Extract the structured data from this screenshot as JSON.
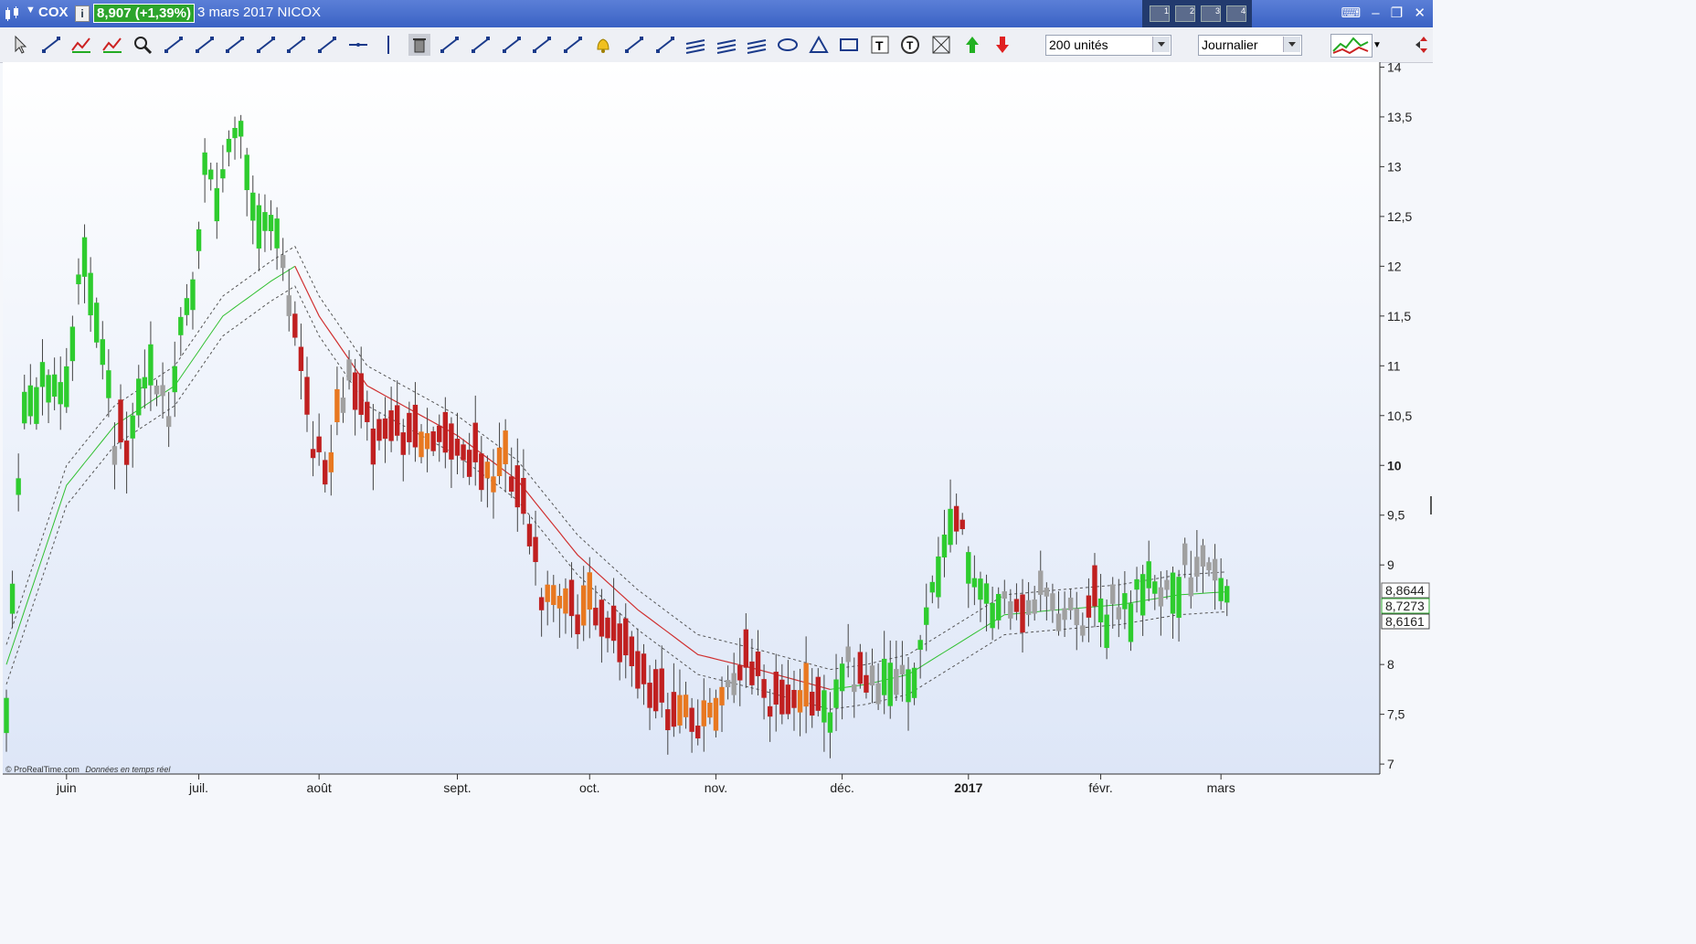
{
  "window": {
    "ticker": "COX",
    "price_badge": "8,907 (+1,39%)",
    "date_name": "3 mars 2017 NICOX",
    "layout_tabs": [
      "1",
      "2",
      "3",
      "4"
    ]
  },
  "toolbar": {
    "units": "200 unités",
    "period": "Journalier",
    "tools": [
      "cursor-icon",
      "ruler-icon",
      "trend-icon",
      "zigzag-icon",
      "zoom-icon",
      "hline-icon",
      "channel-icon",
      "segment-icon",
      "line-icon",
      "ray-icon",
      "extended-line-icon",
      "horizontal-line-icon",
      "vertical-line-icon",
      "delete-icon",
      "crosshair-icon",
      "measure-icon",
      "indicator-icon",
      "fibonacci-icon",
      "fibonacci-fan-icon",
      "alert-bell-icon",
      "andrews-icon",
      "gann-icon",
      "epsilon-icon",
      "raff-icon",
      "sigma-icon",
      "ellipse-icon",
      "triangle-icon",
      "rectangle-icon",
      "text-t-icon",
      "text-bubble-icon",
      "grid-g-icon",
      "arrow-up-icon",
      "arrow-down-icon"
    ]
  },
  "colors": {
    "bull": "#2ecc2e",
    "bear": "#c02020",
    "bear_orange": "#e87820",
    "neutral": "#a0a0a0",
    "mid_line": "#d03030",
    "mid_line_green": "#30c030",
    "band": "#555555",
    "bg_top": "#ffffff",
    "bg_bottom": "#dde6f7"
  },
  "chart_data": {
    "type": "candlestick",
    "period": "Journalier",
    "ylim": [
      6.9,
      14.05
    ],
    "yticks": [
      {
        "v": 14,
        "label": "14"
      },
      {
        "v": 13.5,
        "label": "13,5"
      },
      {
        "v": 13,
        "label": "13"
      },
      {
        "v": 12.5,
        "label": "12,5"
      },
      {
        "v": 12,
        "label": "12"
      },
      {
        "v": 11.5,
        "label": "11,5"
      },
      {
        "v": 11,
        "label": "11"
      },
      {
        "v": 10.5,
        "label": "10,5"
      },
      {
        "v": 10,
        "label": "10",
        "bold": true
      },
      {
        "v": 9.5,
        "label": "9,5"
      },
      {
        "v": 9,
        "label": "9"
      },
      {
        "v": 8,
        "label": "8"
      },
      {
        "v": 7.5,
        "label": "7,5"
      },
      {
        "v": 7,
        "label": "7"
      }
    ],
    "xticks": [
      {
        "i": 10,
        "label": "juin"
      },
      {
        "i": 32,
        "label": "juil."
      },
      {
        "i": 52,
        "label": "août"
      },
      {
        "i": 75,
        "label": "sept."
      },
      {
        "i": 97,
        "label": "oct."
      },
      {
        "i": 118,
        "label": "nov."
      },
      {
        "i": 139,
        "label": "déc."
      },
      {
        "i": 160,
        "label": "2017",
        "bold": true
      },
      {
        "i": 182,
        "label": "févr."
      },
      {
        "i": 202,
        "label": "mars"
      }
    ],
    "price_labels": [
      {
        "v": 8.8644,
        "label": "8,8644",
        "color": "#666666"
      },
      {
        "v": 8.7273,
        "label": "8,7273",
        "color": "#2ca42c"
      },
      {
        "v": 8.6161,
        "label": "8,6161",
        "color": "#444444"
      }
    ],
    "footnote_source": "© ProRealTime.com",
    "footnote_text": "Données en temps réel",
    "anchors": [
      [
        0,
        7.8,
        "bull"
      ],
      [
        3,
        10.8,
        "bull"
      ],
      [
        6,
        10.9,
        "bull"
      ],
      [
        9,
        10.9,
        "bull"
      ],
      [
        11,
        11.3,
        "bull"
      ],
      [
        13,
        12.3,
        "bull"
      ],
      [
        15,
        11.7,
        "bull"
      ],
      [
        17,
        11.0,
        "bull"
      ],
      [
        18,
        10.3,
        "neutral"
      ],
      [
        20,
        10.0,
        "bear"
      ],
      [
        22,
        10.8,
        "bull"
      ],
      [
        24,
        11.2,
        "bull"
      ],
      [
        25,
        10.9,
        "neutral"
      ],
      [
        27,
        10.5,
        "neutral"
      ],
      [
        29,
        11.5,
        "bull"
      ],
      [
        31,
        12.0,
        "bull"
      ],
      [
        33,
        13.0,
        "bull"
      ],
      [
        35,
        12.7,
        "bull"
      ],
      [
        37,
        13.2,
        "bull"
      ],
      [
        39,
        13.5,
        "bull"
      ],
      [
        41,
        12.8,
        "bull"
      ],
      [
        43,
        12.5,
        "bull"
      ],
      [
        45,
        12.6,
        "bull"
      ],
      [
        47,
        11.6,
        "neutral"
      ],
      [
        49,
        11.0,
        "bear"
      ],
      [
        51,
        10.2,
        "bear"
      ],
      [
        53,
        9.8,
        "bear"
      ],
      [
        55,
        10.3,
        "bear_orange"
      ],
      [
        57,
        10.8,
        "neutral"
      ],
      [
        59,
        10.5,
        "bear"
      ],
      [
        61,
        10.1,
        "bear"
      ],
      [
        63,
        10.3,
        "bear"
      ],
      [
        66,
        10.2,
        "bear"
      ],
      [
        68,
        10.1,
        "bear"
      ],
      [
        70,
        10.3,
        "bear_orange"
      ],
      [
        72,
        10.2,
        "bear"
      ],
      [
        75,
        10.1,
        "bear"
      ],
      [
        77,
        10.0,
        "bear"
      ],
      [
        79,
        9.8,
        "bear"
      ],
      [
        81,
        9.8,
        "bear_orange"
      ],
      [
        83,
        9.9,
        "bear_orange"
      ],
      [
        85,
        9.6,
        "bear"
      ],
      [
        87,
        9.2,
        "bear"
      ],
      [
        89,
        8.6,
        "bear"
      ],
      [
        91,
        8.5,
        "bear_orange"
      ],
      [
        93,
        8.5,
        "bear_orange"
      ],
      [
        95,
        8.3,
        "bear"
      ],
      [
        97,
        8.6,
        "bear_orange"
      ],
      [
        99,
        8.3,
        "bear"
      ],
      [
        101,
        8.2,
        "bear"
      ],
      [
        103,
        8.1,
        "bear"
      ],
      [
        105,
        7.9,
        "bear"
      ],
      [
        107,
        7.6,
        "bear"
      ],
      [
        109,
        7.5,
        "bear"
      ],
      [
        111,
        7.4,
        "bear"
      ],
      [
        113,
        7.5,
        "bear_orange"
      ],
      [
        115,
        7.3,
        "bear"
      ],
      [
        117,
        7.35,
        "bear_orange"
      ],
      [
        119,
        7.6,
        "bear_orange"
      ],
      [
        121,
        7.9,
        "neutral"
      ],
      [
        123,
        8.0,
        "bear"
      ],
      [
        125,
        7.8,
        "bear"
      ],
      [
        127,
        7.6,
        "bear"
      ],
      [
        129,
        7.55,
        "bear"
      ],
      [
        131,
        7.6,
        "bear"
      ],
      [
        133,
        7.55,
        "bear_orange"
      ],
      [
        135,
        7.6,
        "bear"
      ],
      [
        137,
        7.6,
        "bull"
      ],
      [
        139,
        8.0,
        "bull"
      ],
      [
        141,
        7.9,
        "neutral"
      ],
      [
        143,
        7.8,
        "bear"
      ],
      [
        145,
        7.9,
        "neutral"
      ],
      [
        147,
        7.95,
        "bull"
      ],
      [
        149,
        7.9,
        "neutral"
      ],
      [
        151,
        8.0,
        "bull"
      ],
      [
        153,
        8.6,
        "bull"
      ],
      [
        155,
        9.1,
        "bull"
      ],
      [
        157,
        9.6,
        "bull"
      ],
      [
        159,
        9.3,
        "bear"
      ],
      [
        161,
        9.0,
        "bull"
      ],
      [
        163,
        8.8,
        "bull"
      ],
      [
        165,
        8.6,
        "bull"
      ],
      [
        167,
        8.5,
        "neutral"
      ],
      [
        169,
        8.4,
        "bear"
      ],
      [
        171,
        8.6,
        "neutral"
      ],
      [
        173,
        8.6,
        "neutral"
      ],
      [
        175,
        8.55,
        "neutral"
      ],
      [
        177,
        8.5,
        "neutral"
      ],
      [
        179,
        8.4,
        "neutral"
      ],
      [
        181,
        8.45,
        "bear"
      ],
      [
        183,
        8.6,
        "bull"
      ],
      [
        185,
        8.7,
        "neutral"
      ],
      [
        187,
        8.7,
        "bull"
      ],
      [
        189,
        9.0,
        "bull"
      ],
      [
        191,
        8.9,
        "bull"
      ],
      [
        193,
        8.8,
        "neutral"
      ],
      [
        195,
        8.9,
        "bull"
      ],
      [
        197,
        8.85,
        "neutral"
      ],
      [
        199,
        8.95,
        "neutral"
      ],
      [
        201,
        8.85,
        "neutral"
      ],
      [
        203,
        8.9,
        "bull"
      ]
    ],
    "bands": {
      "mid": [
        [
          0,
          8.0
        ],
        [
          10,
          9.8
        ],
        [
          18,
          10.4
        ],
        [
          28,
          10.8
        ],
        [
          36,
          11.5
        ],
        [
          44,
          11.85
        ],
        [
          48,
          12.0
        ],
        [
          52,
          11.5
        ],
        [
          60,
          10.8
        ],
        [
          75,
          10.3
        ],
        [
          85,
          9.85
        ],
        [
          95,
          9.1
        ],
        [
          105,
          8.55
        ],
        [
          115,
          8.1
        ],
        [
          125,
          7.95
        ],
        [
          137,
          7.75
        ],
        [
          143,
          7.8
        ],
        [
          150,
          7.9
        ],
        [
          158,
          8.2
        ],
        [
          166,
          8.5
        ],
        [
          175,
          8.55
        ],
        [
          185,
          8.6
        ],
        [
          195,
          8.7
        ],
        [
          203,
          8.73
        ]
      ],
      "split": 48,
      "upper_offset": 0.2,
      "lower_offset": 0.2,
      "bands_end": 203
    }
  }
}
